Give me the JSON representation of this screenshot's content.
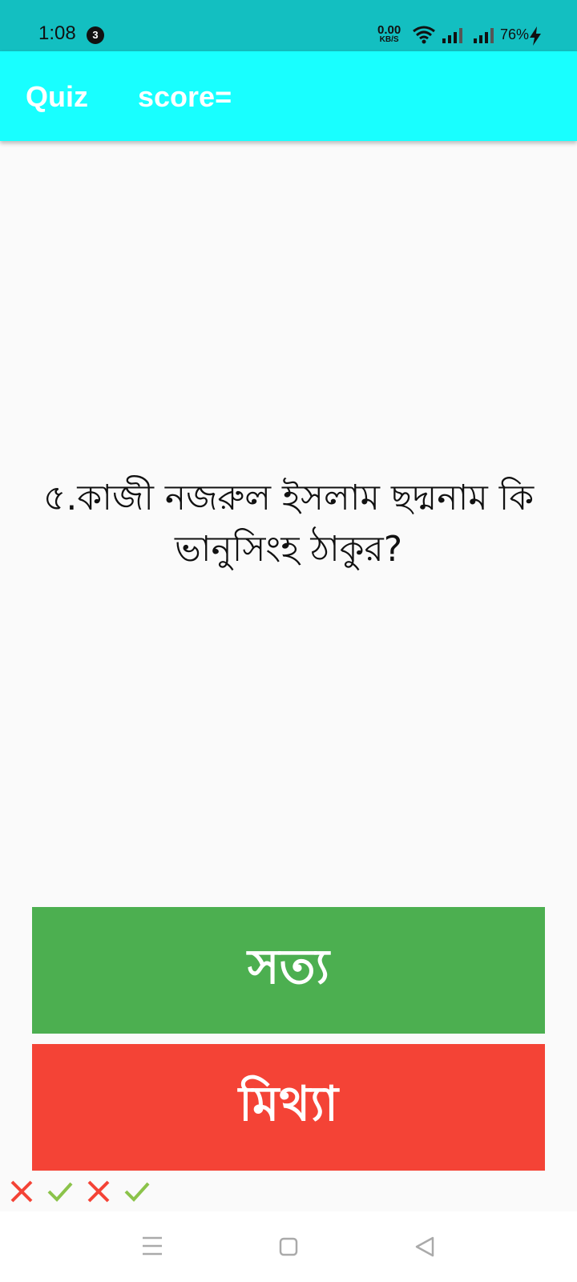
{
  "status_bar": {
    "time": "1:08",
    "notification_count": "3",
    "net_speed_value": "0.00",
    "net_speed_unit": "KB/S",
    "battery": "76%"
  },
  "app_bar": {
    "title": "Quiz",
    "score_label": "score="
  },
  "question": {
    "text": "৫.কাজী নজরুল ইসলাম ছদ্মনাম কি ভানুসিংহ ঠাকুর?"
  },
  "buttons": {
    "true_label": "সত্য",
    "false_label": "মিথ্যা"
  },
  "history": {
    "marks": [
      "wrong",
      "correct",
      "wrong",
      "correct"
    ]
  },
  "colors": {
    "status_bar": "#13bfc1",
    "app_bar": "#18ffff",
    "true_button": "#4caf50",
    "false_button": "#f44336",
    "correct_mark": "#8bc34a",
    "wrong_mark": "#f44336"
  }
}
